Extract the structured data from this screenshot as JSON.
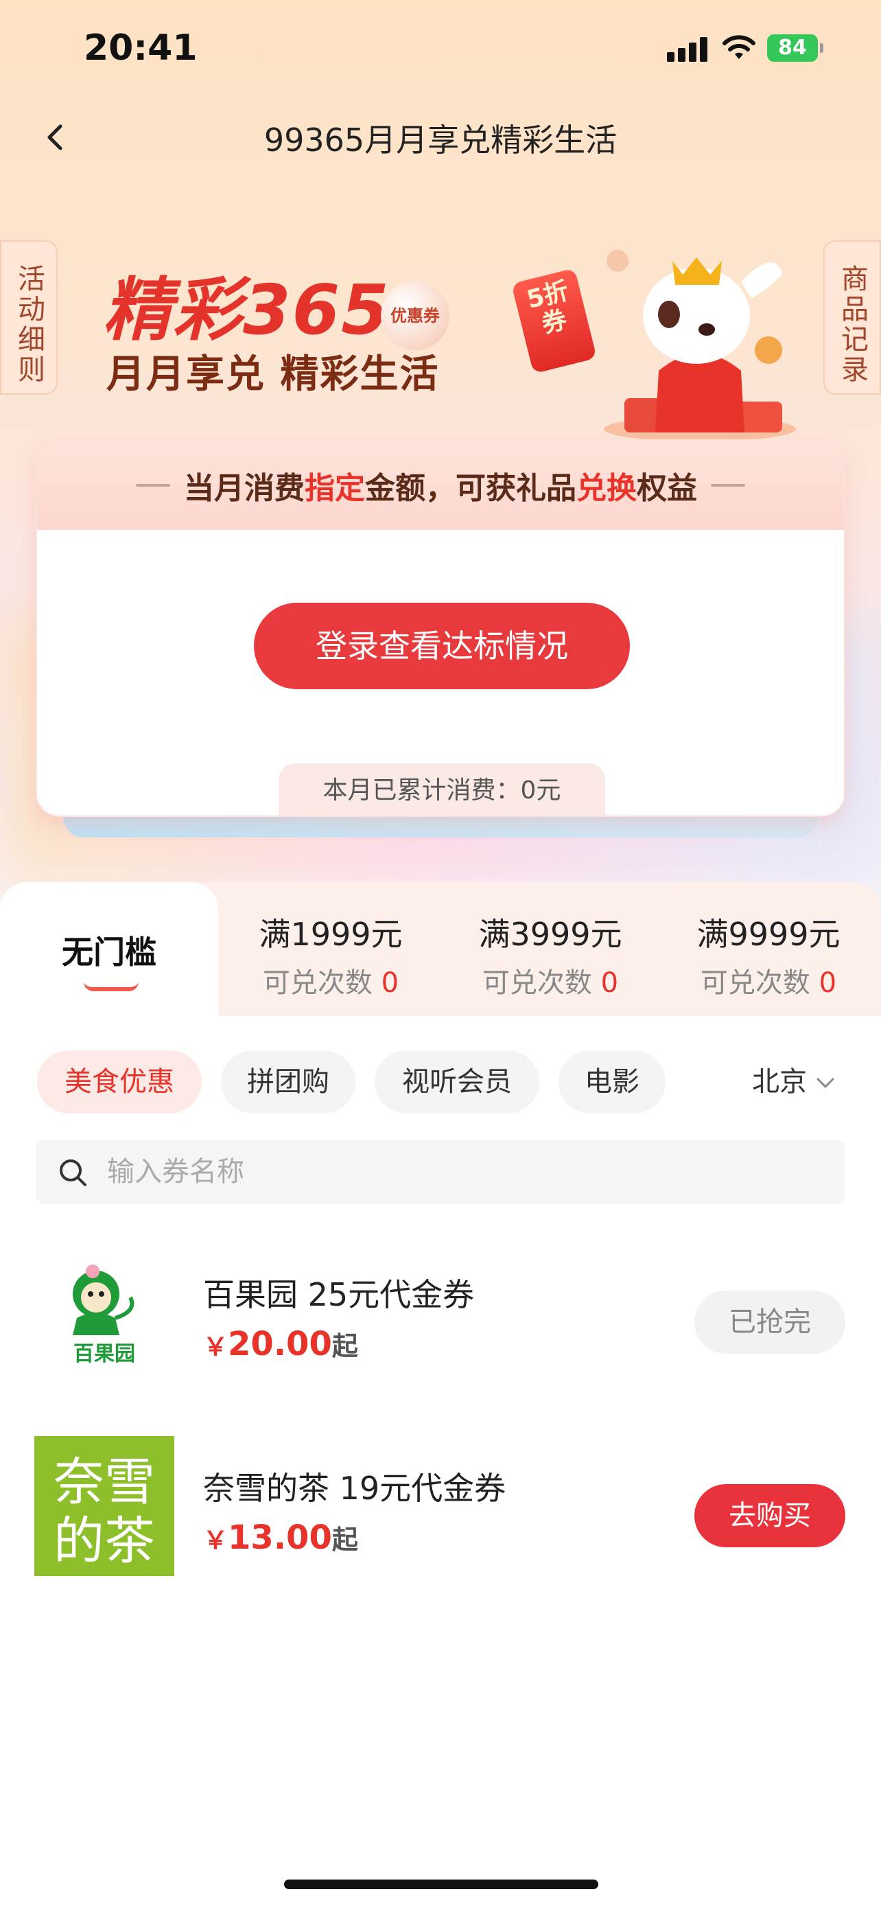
{
  "status_bar": {
    "time": "20:41",
    "battery": "84"
  },
  "nav": {
    "title": "99365月月享兑精彩生活"
  },
  "side_tabs": {
    "left": "活动细则",
    "right": "商品记录"
  },
  "banner": {
    "title": "精彩365",
    "subtitle": "月月享兑 精彩生活",
    "bubble_text": "优惠券",
    "coupon_tag": "5折券"
  },
  "card": {
    "header_pre": "当月消费",
    "header_hl1": "指定",
    "header_mid": "金额，可获礼品",
    "header_hl2": "兑换",
    "header_post": "权益",
    "login_button": "登录查看达标情况",
    "consumption_text": "本月已累计消费：0元"
  },
  "tiers": {
    "active_label": "无门槛",
    "items": [
      {
        "label": "满1999元",
        "count_label": "可兑次数",
        "count": "0"
      },
      {
        "label": "满3999元",
        "count_label": "可兑次数",
        "count": "0"
      },
      {
        "label": "满9999元",
        "count_label": "可兑次数",
        "count": "0"
      }
    ]
  },
  "categories": {
    "items": [
      "美食优惠",
      "拼团购",
      "视听会员",
      "电影"
    ],
    "active_index": 0,
    "city": "北京"
  },
  "search": {
    "placeholder": "输入券名称",
    "value": ""
  },
  "products": [
    {
      "name": "百果园 25元代金券",
      "currency": "￥",
      "price": "20.00",
      "suffix": "起",
      "button": "已抢完",
      "logo_text": "百果园"
    },
    {
      "name": "奈雪的茶 19元代金券",
      "currency": "￥",
      "price": "13.00",
      "suffix": "起",
      "button": "去购买",
      "logo_text": "奈雪的茶"
    }
  ],
  "colors": {
    "accent": "#e8332b",
    "brand_green": "#1f9b3a",
    "nayuki_green": "#8dbf2b"
  }
}
